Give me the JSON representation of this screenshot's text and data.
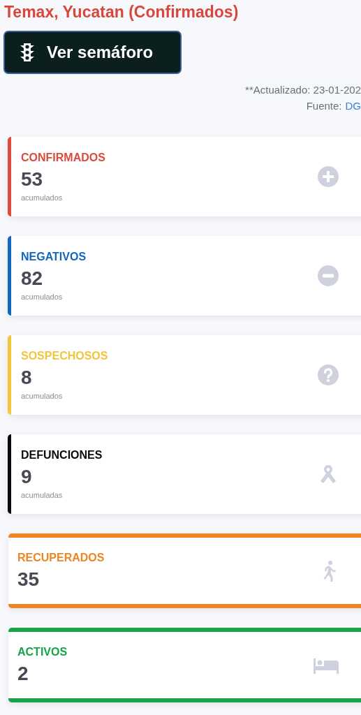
{
  "title": "Temax, Yucatan (Confirmados)",
  "semaforo_button": {
    "label": "Ver semáforo"
  },
  "updated": "**Actualizado: 23-01-202",
  "source": {
    "label": "Fuente:",
    "link": "DG"
  },
  "cards": [
    {
      "kind": "left",
      "label": "CONFIRMADOS",
      "value": "53",
      "sub": "acumulados",
      "color": "#dc4b3e"
    },
    {
      "kind": "left",
      "label": "NEGATIVOS",
      "value": "82",
      "sub": "acumulados",
      "color": "#1266bf"
    },
    {
      "kind": "left",
      "label": "SOSPECHOSOS",
      "value": "8",
      "sub": "acumulados",
      "color": "#f2c53d"
    },
    {
      "kind": "left",
      "label": "DEFUNCIONES",
      "value": "9",
      "sub": "acumuladas",
      "color": "#0a0a0a"
    },
    {
      "kind": "band",
      "label": "RECUPERADOS",
      "value": "35",
      "color": "#ee8522"
    },
    {
      "kind": "band",
      "label": "ACTIVOS",
      "value": "2",
      "color": "#17a34a"
    }
  ]
}
